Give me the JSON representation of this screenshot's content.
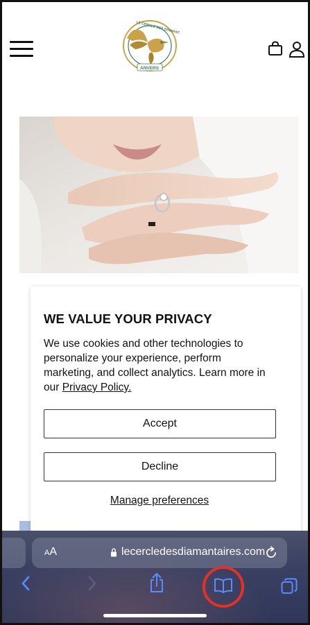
{
  "header": {
    "menu_icon": "hamburger-icon",
    "logo": {
      "arc_text": "LE CERCLE DES DIAMANTAIRES",
      "city_text": "ANVERS",
      "colors": {
        "gold": "#c9a24a",
        "green": "#3f7f5a"
      }
    },
    "cart_icon": "shopping-bag-icon",
    "account_icon": "user-icon"
  },
  "privacy_modal": {
    "title": "WE VALUE YOUR PRIVACY",
    "body_text": "We use cookies and other technologies to personalize your experience, perform marketing, and collect analytics. Learn more in our ",
    "policy_link": "Privacy Policy.",
    "accept_label": "Accept",
    "decline_label": "Decline",
    "manage_label": "Manage preferences"
  },
  "safari": {
    "text_size_label": "AA",
    "url": "lecercledesdiamantaires.com",
    "icons": [
      "chevron-left-icon",
      "chevron-right-icon",
      "share-icon",
      "bookmarks-icon",
      "tabs-icon",
      "reload-icon",
      "lock-icon"
    ],
    "highlight_color": "#e0312b"
  }
}
